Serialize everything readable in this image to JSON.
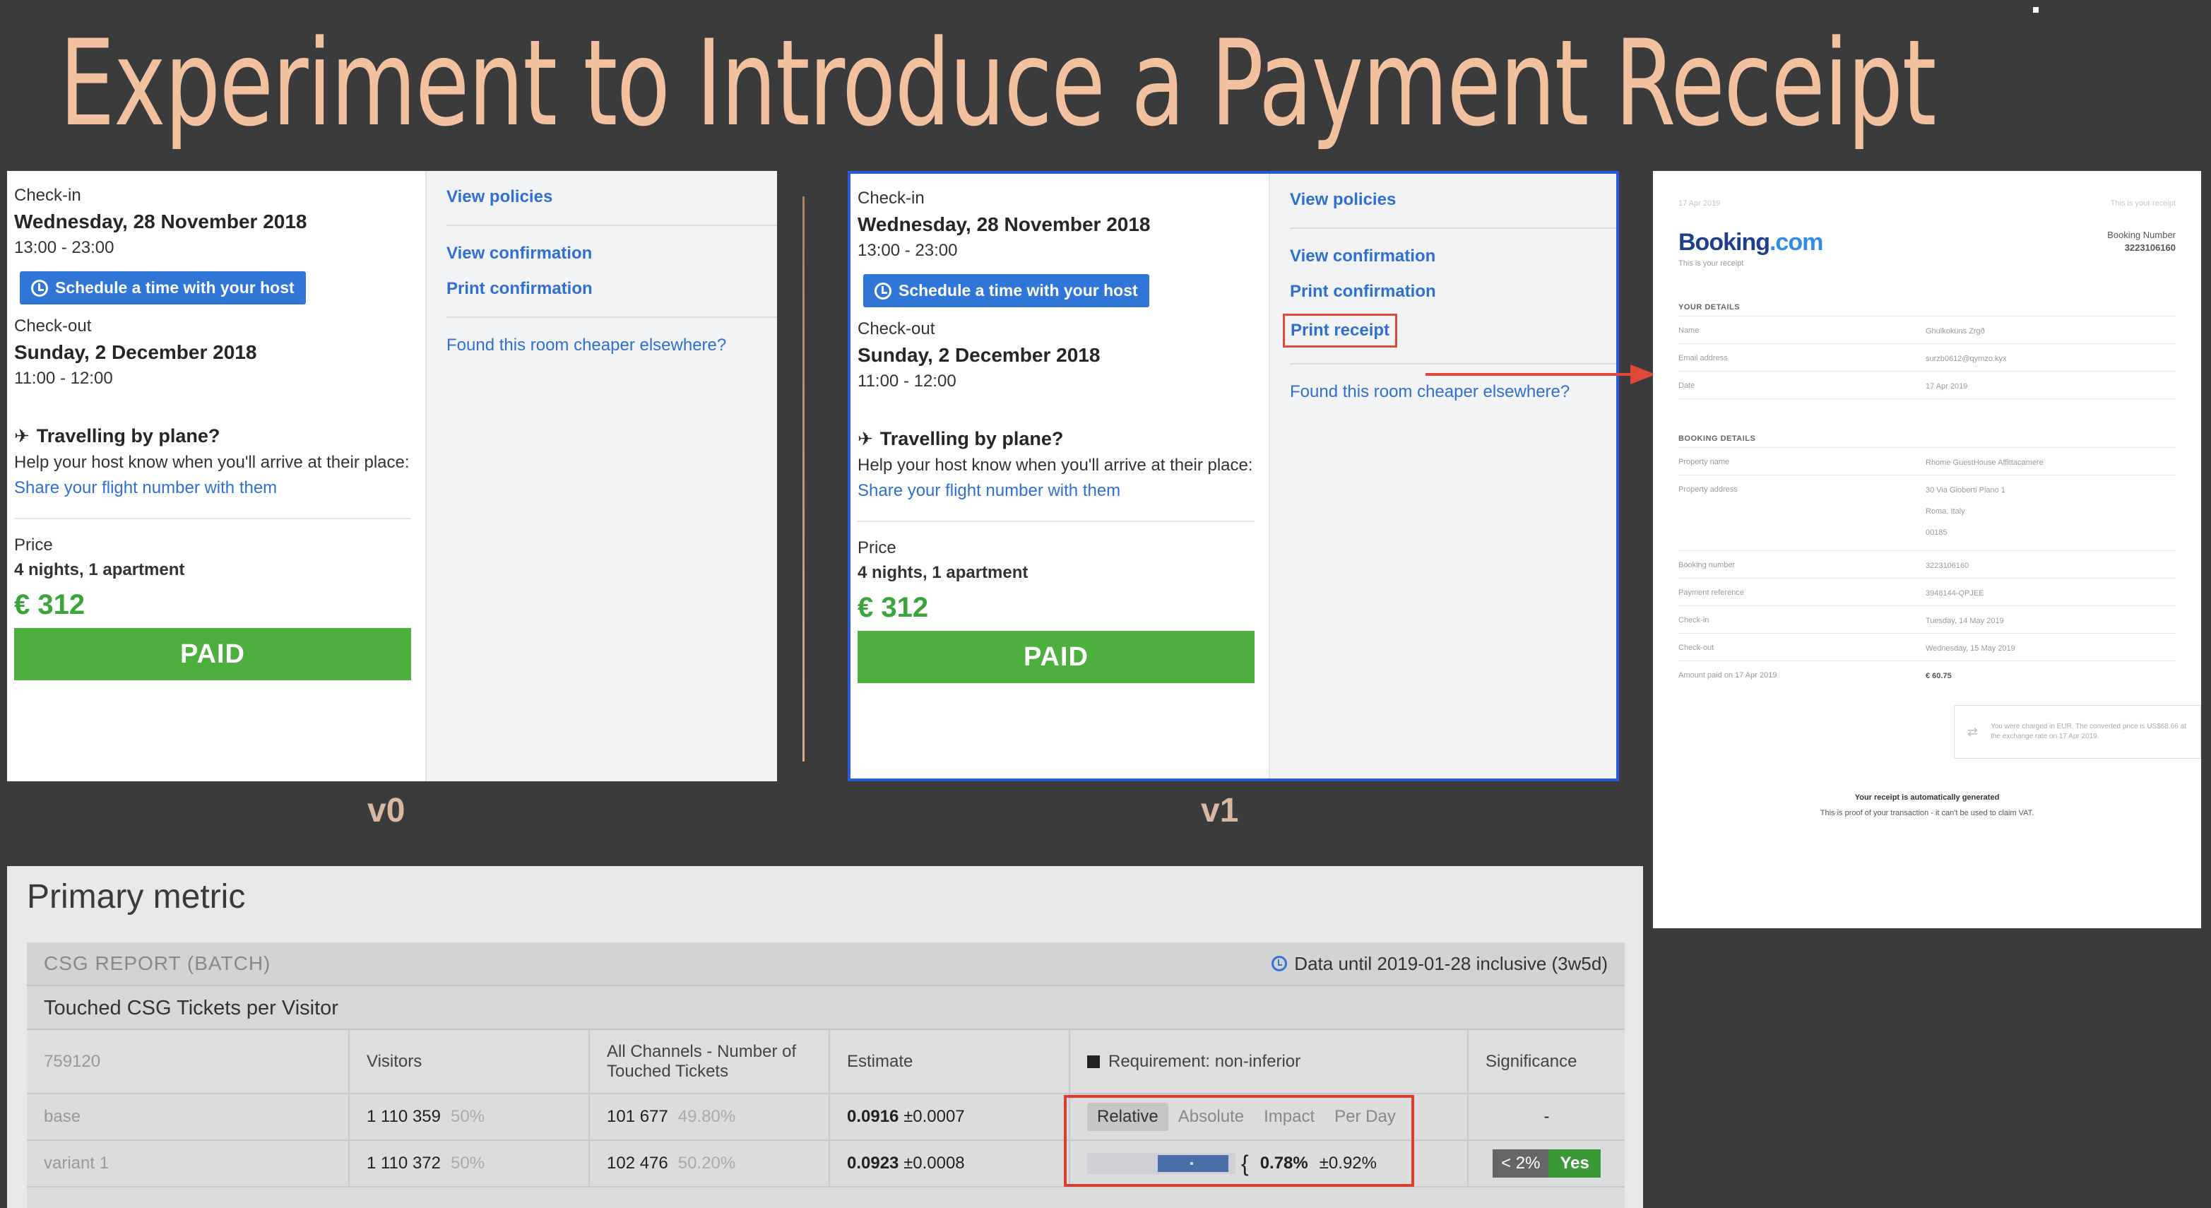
{
  "slide": {
    "title": "Experiment to Introduce a Payment Receipt",
    "v0_label": "v0",
    "v1_label": "v1"
  },
  "booking": {
    "checkin_label": "Check-in",
    "checkin_date": "Wednesday, 28 November 2018",
    "checkin_time": "13:00 - 23:00",
    "schedule_btn": "Schedule a time with your host",
    "checkout_label": "Check-out",
    "checkout_date": "Sunday, 2 December 2018",
    "checkout_time": "11:00 - 12:00",
    "travel_head": "Travelling by plane?",
    "travel_text": "Help your host know when you'll arrive at their place:",
    "flight_link": "Share your flight number with them",
    "price_label": "Price",
    "price_detail": "4 nights, 1 apartment",
    "price_value": "€ 312",
    "paid_btn": "PAID",
    "view_policies": "View policies",
    "view_confirmation": "View confirmation",
    "print_confirmation": "Print confirmation",
    "print_receipt": "Print receipt",
    "cheaper_link": "Found this room cheaper elsewhere?"
  },
  "receipt": {
    "top_left": "17 Apr 2019",
    "top_right": "This is your receipt",
    "brand_main": "Booking",
    "brand_dot": ".com",
    "brand_sub": "This is your receipt",
    "booking_number_label": "Booking Number",
    "booking_number": "3223106160",
    "your_details": "YOUR DETAILS",
    "details": [
      {
        "k": "Name",
        "v": "Ghulkokuns Zrgð"
      },
      {
        "k": "Email address",
        "v": "surzb0612@qymzo.kyx"
      },
      {
        "k": "Date",
        "v": "17 Apr 2019"
      }
    ],
    "booking_details": "BOOKING DETAILS",
    "property_name_k": "Property name",
    "property_name_v": "Rhome GuestHouse Affittacamere",
    "property_address_k": "Property address",
    "property_address_1": "30 Via Gioberti Piano 1",
    "property_address_2": "Roma, Italy",
    "property_address_3": "00185",
    "rows": [
      {
        "k": "Booking number",
        "v": "3223106160"
      },
      {
        "k": "Payment reference",
        "v": "3948144-QPJEE"
      },
      {
        "k": "Check-in",
        "v": "Tuesday, 14 May 2019"
      },
      {
        "k": "Check-out",
        "v": "Wednesday, 15 May 2019"
      },
      {
        "k": "Amount paid on 17 Apr 2019",
        "v": "€ 60.75"
      }
    ],
    "note": "You were charged in EUR. The converted price is US$68.66 at the exchange rate on 17 Apr 2019.",
    "foot_1": "Your receipt is automatically generated",
    "foot_2": "This is proof of your transaction - it can't be used to claim VAT."
  },
  "metric": {
    "title": "Primary metric",
    "report_title": "CSG REPORT (BATCH)",
    "data_until": "Data until 2019-01-28 inclusive (3w5d)",
    "sub_title": "Touched CSG Tickets per Visitor",
    "headers": {
      "id": "759120",
      "visitors": "Visitors",
      "channels": "All Channels - Number of Touched Tickets",
      "estimate": "Estimate",
      "requirement": "Requirement: non-inferior",
      "significance": "Significance"
    },
    "tabs": [
      "Relative",
      "Absolute",
      "Impact",
      "Per Day"
    ],
    "base": {
      "name": "base",
      "visitors": "1 110 359",
      "visitors_pct": "50%",
      "tickets": "101 677",
      "tickets_pct": "49.80%",
      "estimate": "0.0916",
      "estimate_err": "±0.0007",
      "significance": "-"
    },
    "variant": {
      "name": "variant 1",
      "visitors": "1 110 372",
      "visitors_pct": "50%",
      "tickets": "102 476",
      "tickets_pct": "50.20%",
      "estimate": "0.0923",
      "estimate_err": "±0.0008",
      "relative": "0.78%",
      "relative_err": "±0.92%",
      "sig_lt": "< 2%",
      "sig_yes": "Yes"
    }
  }
}
